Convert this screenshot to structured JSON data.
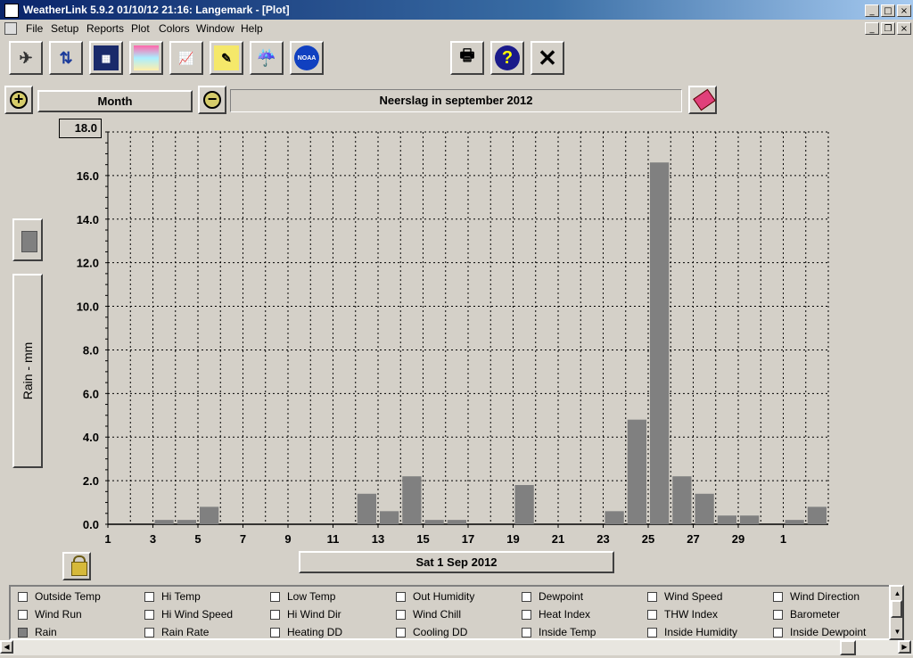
{
  "window": {
    "title": "WeatherLink 5.9.2  01/10/12  21:16: Langemark - [Plot]"
  },
  "menu": [
    "File",
    "Setup",
    "Reports",
    "Plot",
    "Colors",
    "Window",
    "Help"
  ],
  "toolbar": {
    "icons": [
      "connect-icon",
      "download-icon",
      "bulletin-icon",
      "strip-chart-icon",
      "browse-icon",
      "notes-icon",
      "rain-icon",
      "noaa-icon",
      "print-icon",
      "help-icon",
      "close-icon"
    ],
    "noaa_label": "NOAA"
  },
  "plot_controls": {
    "period_label": "Month",
    "plot_title": "Neerslag in september 2012",
    "y_max_value": "18.0",
    "y_axis_label": "Rain - mm",
    "date_label": "Sat 1 Sep 2012"
  },
  "chart_data": {
    "type": "bar",
    "title": "Neerslag in september 2012",
    "ylabel": "Rain - mm",
    "ylim": [
      0,
      18
    ],
    "yticks": [
      "0.0",
      "2.0",
      "4.0",
      "6.0",
      "8.0",
      "10.0",
      "12.0",
      "14.0",
      "16.0"
    ],
    "xtick_labels": [
      "1",
      "3",
      "5",
      "7",
      "9",
      "11",
      "13",
      "15",
      "17",
      "19",
      "21",
      "23",
      "25",
      "27",
      "29",
      "1"
    ],
    "days": [
      1,
      2,
      3,
      4,
      5,
      6,
      7,
      8,
      9,
      10,
      11,
      12,
      13,
      14,
      15,
      16,
      17,
      18,
      19,
      20,
      21,
      22,
      23,
      24,
      25,
      26,
      27,
      28,
      29,
      30,
      31,
      32
    ],
    "values": [
      0,
      0,
      0.2,
      0.2,
      0.8,
      0,
      0,
      0,
      0,
      0,
      0,
      1.4,
      0.6,
      2.2,
      0.2,
      0.2,
      0,
      0,
      1.8,
      0,
      0,
      0,
      0.6,
      4.8,
      16.6,
      2.2,
      1.4,
      0.4,
      0.4,
      0,
      0.2,
      0.8
    ],
    "grid": true,
    "bar_color": "#808080"
  },
  "checkboxes": [
    {
      "label": "Outside Temp",
      "checked": false
    },
    {
      "label": "Hi Temp",
      "checked": false
    },
    {
      "label": "Low Temp",
      "checked": false
    },
    {
      "label": "Out Humidity",
      "checked": false
    },
    {
      "label": "Dewpoint",
      "checked": false
    },
    {
      "label": "Wind Speed",
      "checked": false
    },
    {
      "label": "Wind Direction",
      "checked": false
    },
    {
      "label": "Wind Run",
      "checked": false
    },
    {
      "label": "Hi Wind Speed",
      "checked": false
    },
    {
      "label": "Hi Wind Dir",
      "checked": false
    },
    {
      "label": "Wind Chill",
      "checked": false
    },
    {
      "label": "Heat Index",
      "checked": false
    },
    {
      "label": "THW Index",
      "checked": false
    },
    {
      "label": "Barometer",
      "checked": false
    },
    {
      "label": "Rain",
      "checked": true
    },
    {
      "label": "Rain Rate",
      "checked": false
    },
    {
      "label": "Heating DD",
      "checked": false
    },
    {
      "label": "Cooling DD",
      "checked": false
    },
    {
      "label": "Inside Temp",
      "checked": false
    },
    {
      "label": "Inside Humidity",
      "checked": false
    },
    {
      "label": "Inside Dewpoint",
      "checked": false
    }
  ]
}
